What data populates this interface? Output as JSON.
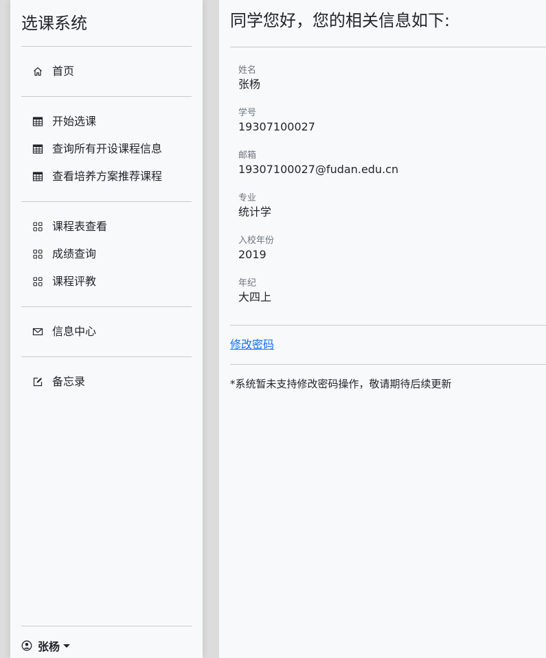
{
  "sidebar": {
    "brand": "选课系统",
    "items": [
      {
        "label": "首页",
        "icon": "home-icon"
      },
      {
        "label": "开始选课",
        "icon": "table-icon"
      },
      {
        "label": "查询所有开设课程信息",
        "icon": "table-icon"
      },
      {
        "label": "查看培养方案推荐课程",
        "icon": "table-icon"
      },
      {
        "label": "课程表查看",
        "icon": "grid-icon"
      },
      {
        "label": "成绩查询",
        "icon": "grid-icon"
      },
      {
        "label": "课程评教",
        "icon": "grid-icon"
      },
      {
        "label": "信息中心",
        "icon": "envelope-icon"
      },
      {
        "label": "备忘录",
        "icon": "pencil-square-icon"
      }
    ],
    "user": {
      "name": "张杨",
      "icon": "person-circle-icon"
    }
  },
  "main": {
    "title": "同学您好，您的相关信息如下:",
    "fields": [
      {
        "label": "姓名",
        "value": "张杨"
      },
      {
        "label": "学号",
        "value": "19307100027"
      },
      {
        "label": "邮箱",
        "value": "19307100027@fudan.edu.cn"
      },
      {
        "label": "专业",
        "value": "统计学"
      },
      {
        "label": "入校年份",
        "value": "2019"
      },
      {
        "label": "年纪",
        "value": "大四上"
      }
    ],
    "change_password_link": "修改密码",
    "note": "*系统暂未支持修改密码操作，敬请期待后续更新"
  },
  "colors": {
    "link": "#0d6efd",
    "background": "#f8f9fa",
    "divider": "#c8c8c8"
  }
}
